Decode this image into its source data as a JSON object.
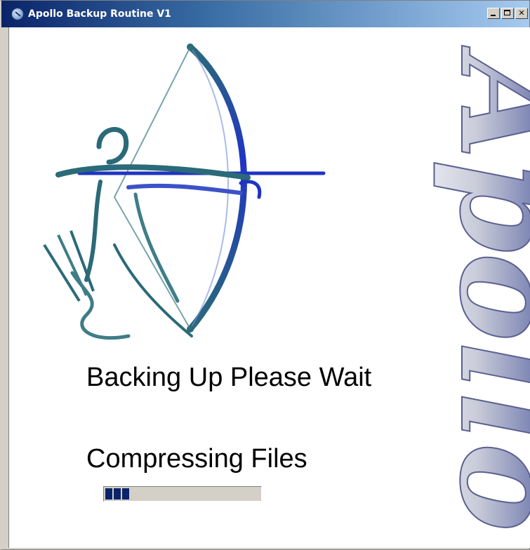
{
  "window": {
    "title": "Apollo Backup Routine V1",
    "icon": "apollo-app-icon",
    "buttons": [
      "minimize-icon",
      "maximize-icon",
      "close-icon"
    ]
  },
  "logo": {
    "archer_icon": "archer-logo",
    "wordmark": "Apollo"
  },
  "status": {
    "main": "Backing Up Please Wait",
    "sub": "Compressing Files"
  },
  "progress": {
    "blocks_filled": 3,
    "fraction": 0.2
  },
  "colors": {
    "title_gradient_start": "#0a246a",
    "title_gradient_end": "#a6caf0",
    "progress_block": "#0a246a",
    "archer_blue": "#1f34c4",
    "archer_teal": "#2b6a78"
  }
}
